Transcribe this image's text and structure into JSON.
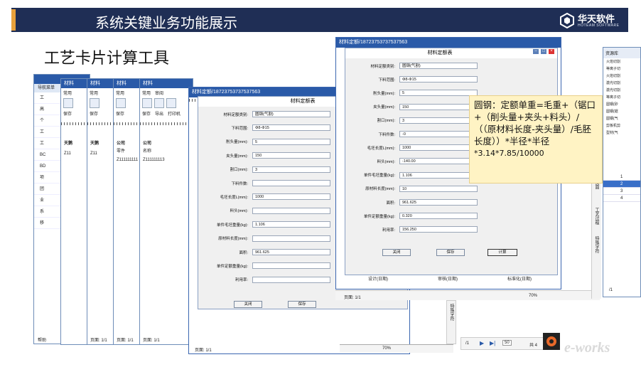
{
  "slide": {
    "title": "系统关键业务功能展示",
    "section_heading": "工艺卡片计算工具"
  },
  "brand": {
    "name": "华天软件",
    "subtitle": "HOTEAM SOFTWARE"
  },
  "colors": {
    "header_bg": "#1f2e55",
    "accent": "#e8a13b",
    "titlebar": "#2a5aa8",
    "formula_bg": "#fff3c4"
  },
  "left_app": {
    "nav_header": "导航菜单",
    "nav_items": [
      "工",
      "高",
      "个",
      "工",
      "工",
      "BC",
      "BD",
      "项",
      "团",
      "业",
      "系",
      "移"
    ],
    "bottom_help": "帮助"
  },
  "window_tabs": [
    {
      "title": "材料"
    },
    {
      "title": "材料"
    },
    {
      "title": "材料"
    },
    {
      "title": "材料"
    },
    {
      "title": "材料定额/18723753737537563"
    }
  ],
  "ribbon": {
    "tabs": [
      "常用",
      "常用",
      "常用",
      "常用",
      "审阅"
    ],
    "buttons": [
      "保存",
      "导出",
      "打印机"
    ],
    "extra": "文"
  },
  "doc_fragments": {
    "col_a": "天鹅",
    "col_b": "天鹅",
    "col_c": "公司",
    "col_d": "公司",
    "col_e": "材料消耗工",
    "row_label": "零件",
    "name_label": "名称",
    "code_a": "Z11",
    "code_b": "Z11",
    "code_c": "Z111111111",
    "code_d": "Z111111113",
    "num_a": "1",
    "num_b": "1",
    "num_c": "1",
    "per": "件/台",
    "page": "页面: 1/1"
  },
  "dialog_back": {
    "window_title": "材料定额/18723753737537563",
    "title": "材料定额表",
    "fields": [
      {
        "label": "材料定额类别:",
        "value": "圆钢(气割)"
      },
      {
        "label": "下料范围:",
        "value": "Φ8-Φ15"
      },
      {
        "label": "削头量(mm):",
        "value": "5"
      },
      {
        "label": "夹头量(mm):",
        "value": "150"
      },
      {
        "label": "割口(mm):",
        "value": "3"
      },
      {
        "label": "下料件数:",
        "value": ""
      },
      {
        "label": "毛坯长度L(mm):",
        "value": "1000"
      },
      {
        "label": "料头(mm):",
        "value": ""
      },
      {
        "label": "单件毛坯重量(kg):",
        "value": "1.106"
      },
      {
        "label": "原材料长度(mm):",
        "value": ""
      },
      {
        "label": "面积:",
        "value": "961.625"
      },
      {
        "label": "单件定额重量(kg):",
        "value": ""
      },
      {
        "label": "利用率:",
        "value": ""
      }
    ],
    "buttons": [
      "关闭",
      "保存"
    ]
  },
  "dialog_front": {
    "window_title": "材料定额/18723753737537563",
    "title": "材料定额表",
    "fields": [
      {
        "label": "材料定额类别:",
        "value": "圆钢(气割)"
      },
      {
        "label": "下料范围:",
        "value": "Φ8-Φ15"
      },
      {
        "label": "削头量(mm):",
        "value": "5"
      },
      {
        "label": "夹头量(mm):",
        "value": "150"
      },
      {
        "label": "割口(mm):",
        "value": "3"
      },
      {
        "label": "下料件数:",
        "value": "-0"
      },
      {
        "label": "毛坯长度L(mm):",
        "value": "1000"
      },
      {
        "label": "料头(mm):",
        "value": "-140.00"
      },
      {
        "label": "单件毛坯重量(kg):",
        "value": "1.106"
      },
      {
        "label": "原材料长度(mm):",
        "value": "10"
      },
      {
        "label": "面积:",
        "value": "961.625"
      },
      {
        "label": "单件定额重量(kg):",
        "value": "0.320"
      },
      {
        "label": "利用率:",
        "value": "156.250"
      }
    ],
    "buttons": [
      "关闭",
      "保存",
      "计算"
    ],
    "footer_cols": [
      "设计(日期)",
      "审核(日期)",
      "标准化(日期)"
    ],
    "page": "页面: 1/1",
    "zoom": "70%"
  },
  "right_panel": {
    "header": "资源库",
    "tree": [
      "火焰切割",
      "等离子切",
      "火焰切割",
      "激光切割",
      "激光切割",
      "等离子切",
      "圆钢(砂",
      "圆钢(锯",
      "圆钢(气",
      "剪板机剪",
      "型材(气"
    ],
    "side_tabs": [
      "页面",
      "工艺过程",
      "特殊字符"
    ],
    "grid_rows": [
      "1",
      "2",
      "3",
      "4"
    ],
    "pager": {
      "page": "/1",
      "page_size": "50",
      "total": "共 4"
    }
  },
  "formula": {
    "text": "圆钢：定额单重=毛重+（锯口+（削头量+夹头+料头）/（（原材料长度-夹头量）/毛胚长度））*半径*半径",
    "tail": "*3.14*7.85/10000"
  },
  "watermark": "e-works"
}
